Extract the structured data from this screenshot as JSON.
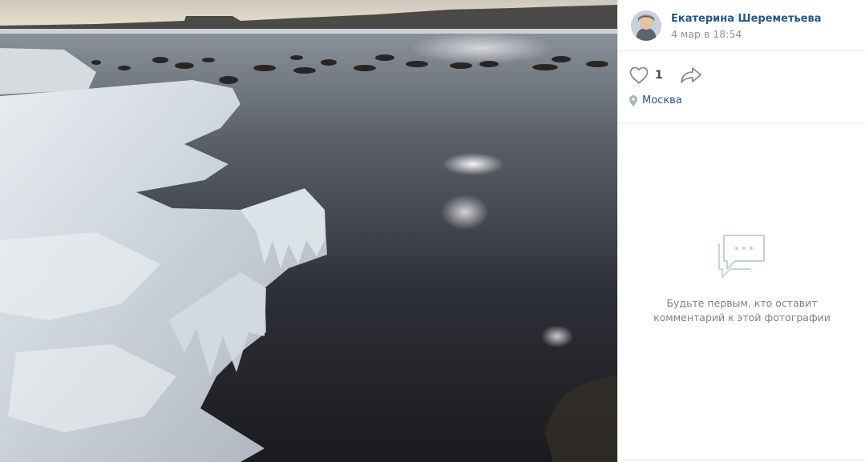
{
  "post": {
    "author_name": "Екатерина Шереметьева",
    "date": "4 мар в 18:54"
  },
  "actions": {
    "like_icon": "heart-outline-icon",
    "like_count": "1",
    "share_icon": "share-arrow-icon"
  },
  "location": {
    "icon": "map-pin-icon",
    "name": "Москва"
  },
  "comments": {
    "empty_icon": "speech-bubble-icon",
    "empty_line_1": "Будьте первым, кто оставит",
    "empty_line_2": "комментарий к этой фотографии"
  },
  "colors": {
    "link": "#2a5885",
    "muted": "#939393",
    "divider": "#e7e8ec"
  }
}
